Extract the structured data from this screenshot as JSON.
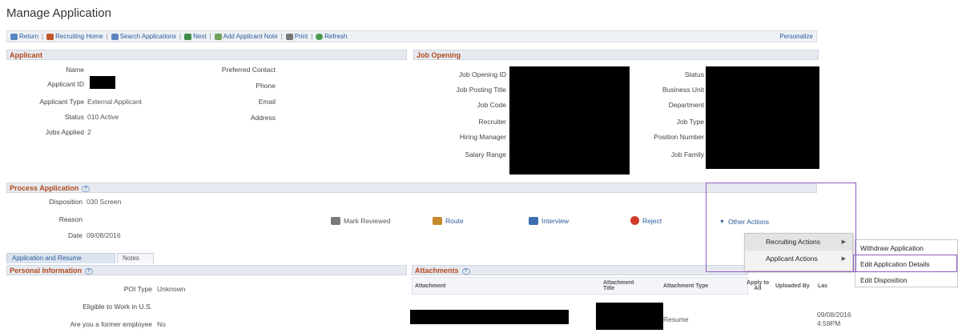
{
  "page": {
    "title": "Manage Application"
  },
  "toolbar": {
    "items": [
      "Return",
      "Recruiting Home",
      "Search Applications",
      "Next",
      "Add Applicant Note",
      "Print",
      "Refresh"
    ],
    "personalize": "Personalize"
  },
  "applicant": {
    "header": "Applicant",
    "labels": {
      "name": "Name",
      "applicant_id": "Applicant ID",
      "applicant_type": "Applicant Type",
      "status": "Status",
      "jobs_applied": "Jobs Applied",
      "preferred_contact": "Preferred Contact",
      "phone": "Phone",
      "email": "Email",
      "address": "Address"
    },
    "values": {
      "applicant_type": "External Applicant",
      "status": "010 Active",
      "jobs_applied": "2"
    }
  },
  "job_opening": {
    "header": "Job Opening",
    "labels": {
      "job_opening_id": "Job Opening ID",
      "job_posting_title": "Job Posting Title",
      "job_code": "Job Code",
      "recruiter": "Recruiter",
      "hiring_manager": "Hiring Manager",
      "salary_range": "Salary Range",
      "status": "Status",
      "business_unit": "Business Unit",
      "department": "Department",
      "job_type": "Job Type",
      "position_number": "Position Number",
      "job_family": "Job Family"
    }
  },
  "process": {
    "header": "Process Application",
    "help": "?",
    "labels": {
      "disposition": "Disposition",
      "reason": "Reason",
      "date": "Date"
    },
    "values": {
      "disposition": "030 Screen",
      "date": "09/08/2016"
    },
    "actions": {
      "mark_reviewed": "Mark Reviewed",
      "route": "Route",
      "interview": "Interview",
      "reject": "Reject",
      "other_actions": "Other Actions"
    }
  },
  "other_actions_menu": {
    "items": [
      "Recruiting Actions",
      "Applicant Actions"
    ],
    "submenu": [
      "Withdraw Application",
      "Edit Application Details",
      "Edit Disposition"
    ]
  },
  "tabs": [
    "Application and Resume",
    "Notes"
  ],
  "personal_info": {
    "header": "Personal Information",
    "help": "?",
    "labels": {
      "poi_type": "POI Type",
      "eligible": "Eligible to Work in U.S.",
      "former_employee": "Are you a former employee"
    },
    "values": {
      "poi_type": "Unknown",
      "former_employee": "No"
    }
  },
  "attachments": {
    "header": "Attachments",
    "help": "?",
    "columns": [
      "Attachment",
      "Attachment Title",
      "Attachment Type",
      "Apply to All",
      "Uploaded By",
      "Las"
    ],
    "row": {
      "type": "Resume",
      "date": "09/08/2016",
      "time": "4:59PM"
    }
  },
  "colors": {
    "section_header_text": "#b34a1e",
    "link": "#2a5a9a",
    "highlight_box": "#8f5cc4"
  }
}
